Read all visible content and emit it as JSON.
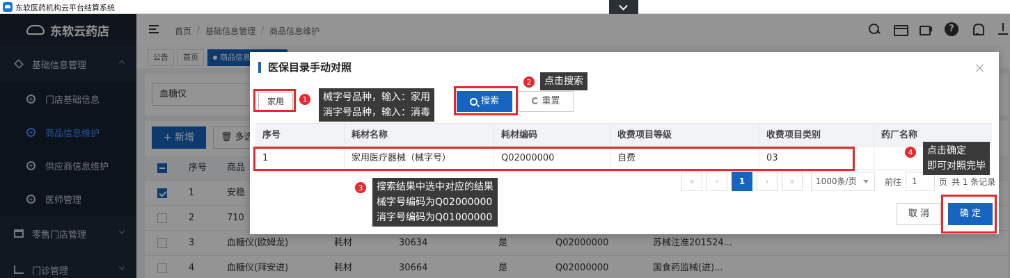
{
  "window": {
    "title": "东软医药机构云平台结算系统"
  },
  "sidebar": {
    "logo": "东软云药店",
    "groups": [
      {
        "label": "基础信息管理",
        "icon": "layers-icon"
      },
      {
        "label": "零售门店管理",
        "icon": "shop-icon"
      },
      {
        "label": "门诊管理",
        "icon": "clinic-icon"
      }
    ],
    "sub_items": [
      {
        "label": "门店基础信息"
      },
      {
        "label": "商品信息维护"
      },
      {
        "label": "供应商信息维护"
      },
      {
        "label": "医师管理"
      }
    ],
    "active_color": "#3d8eff"
  },
  "header": {
    "breadcrumb": [
      "首页",
      "基础信息管理",
      "商品信息维护"
    ],
    "icons": [
      "search-icon",
      "card-icon",
      "video-icon",
      "help-icon",
      "bell-icon",
      "download-icon"
    ]
  },
  "tabs": [
    "公告",
    "首页",
    "商品信息"
  ],
  "page": {
    "filter_value": "血糖仪",
    "add_label": "+ 新增",
    "multi_label": "多选",
    "table_head": {
      "seq": "序号",
      "name": "商品"
    },
    "rows": [
      {
        "seq": "1",
        "name": "安稳",
        "type": "",
        "code": "",
        "flag": "",
        "insur": "",
        "reg": "",
        "checked": true
      },
      {
        "seq": "2",
        "name": "710",
        "type": "",
        "code": "",
        "flag": "",
        "insur": "",
        "reg": "",
        "checked": false
      },
      {
        "seq": "3",
        "name": "血糖仪(欧姆龙)",
        "type": "耗材",
        "code": "30634",
        "flag": "是",
        "insur": "Q02000000",
        "reg": "苏械注准201524...",
        "checked": false
      },
      {
        "seq": "4",
        "name": "血糖仪(拜安进)",
        "type": "耗材",
        "code": "30664",
        "flag": "是",
        "insur": "Q02000000",
        "reg": "国食药监械(进)...",
        "checked": false
      }
    ]
  },
  "dialog": {
    "title": "医保目录手动对照",
    "search_value": "家用",
    "search_label": "搜索",
    "reset_label": "重置",
    "columns": [
      "序号",
      "耗材名称",
      "耗材编码",
      "收费项目等级",
      "收费项目类别",
      "药厂名称"
    ],
    "rows": [
      [
        "1",
        "家用医疗器械（械字号）",
        "Q02000000",
        "自费",
        "03",
        ""
      ]
    ],
    "pager": {
      "current": "1",
      "page_size": "1000条/页",
      "goto_prefix": "前往",
      "goto_value": "1",
      "goto_suffix": "页",
      "total": "共 1 条记录"
    },
    "cancel_label": "取 消",
    "confirm_label": "确 定"
  },
  "annotations": [
    {
      "num": "1",
      "lines": [
        "械字号品种，输入：家用",
        "消字号品种，输入：消毒"
      ]
    },
    {
      "num": "2",
      "lines": [
        "点击搜索"
      ]
    },
    {
      "num": "3",
      "lines": [
        "搜索结果中选中对应的结果",
        "械字号编码为Q02000000",
        "消字号编码为Q01000000"
      ]
    },
    {
      "num": "4",
      "lines": [
        "点击确定",
        "即可对照完毕"
      ]
    }
  ],
  "colors": {
    "primary": "#1664c0",
    "annotation_red": "#e8262b",
    "sidebar_bg": "#1f2a3a"
  }
}
